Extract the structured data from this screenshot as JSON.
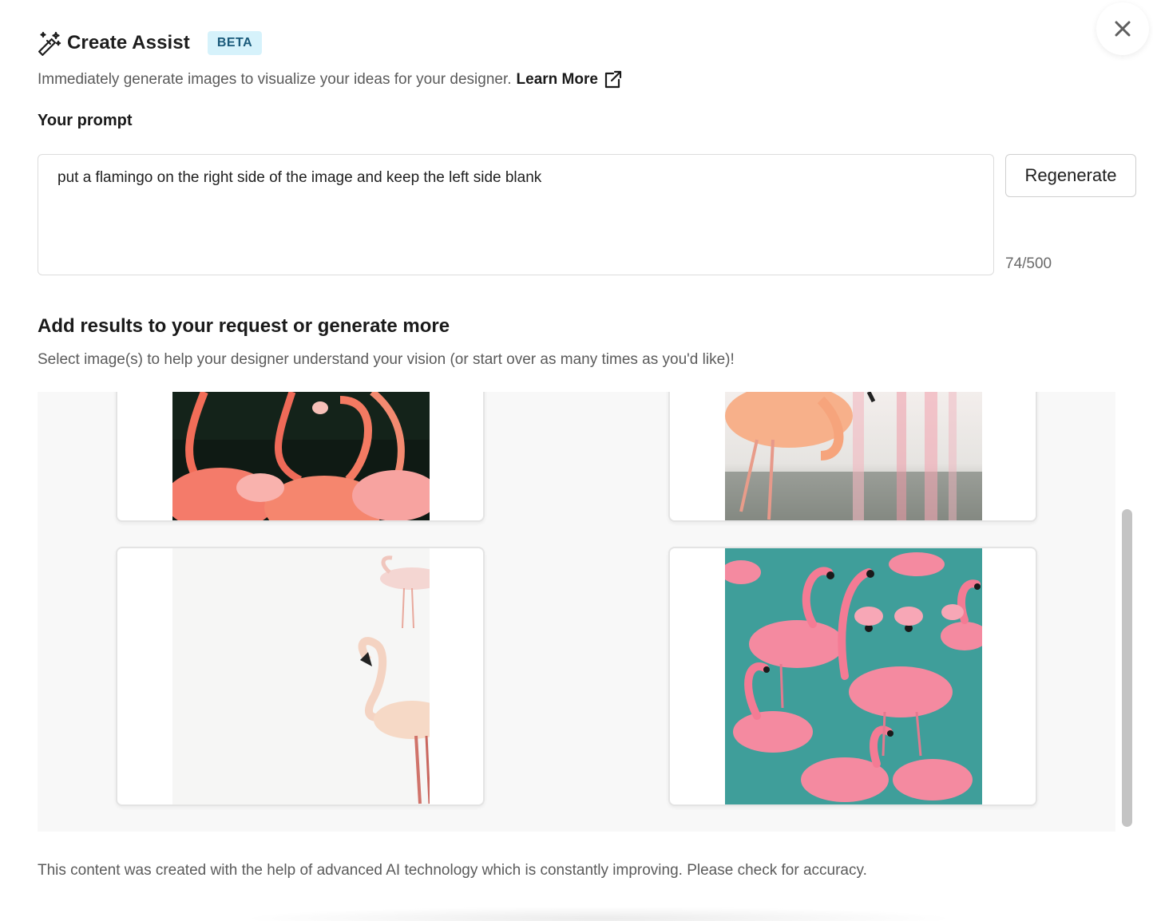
{
  "header": {
    "title": "Create Assist",
    "badge": "BETA",
    "icon": "magic-wand-icon",
    "close_icon": "close-icon"
  },
  "intro": {
    "text": "Immediately generate images to visualize your ideas for your designer.",
    "learn_more_label": "Learn More",
    "learn_more_icon": "external-link-icon"
  },
  "prompt": {
    "label": "Your prompt",
    "value": "put a flamingo on the right side of the image and keep the left side blank",
    "counter": "74/500",
    "regenerate_label": "Regenerate"
  },
  "results": {
    "title": "Add results to your request or generate more",
    "subtitle": "Select image(s) to help your designer understand your vision (or start over as many times as you'd like)!",
    "images": [
      {
        "description": "flamingos on dark background"
      },
      {
        "description": "single orange flamingo wading in water"
      },
      {
        "description": "white flamingos on pale background, right side"
      },
      {
        "description": "pattern of pink flamingos on teal background"
      }
    ]
  },
  "disclaimer": "This content was created with the help of advanced AI technology which is constantly improving. Please check for accuracy.",
  "colors": {
    "beta_bg": "#d6f2fb",
    "beta_text": "#1a5a7a",
    "teal": "#3f9e9a",
    "flamingo_pink": "#f48aa0",
    "flamingo_coral": "#f26d58"
  }
}
